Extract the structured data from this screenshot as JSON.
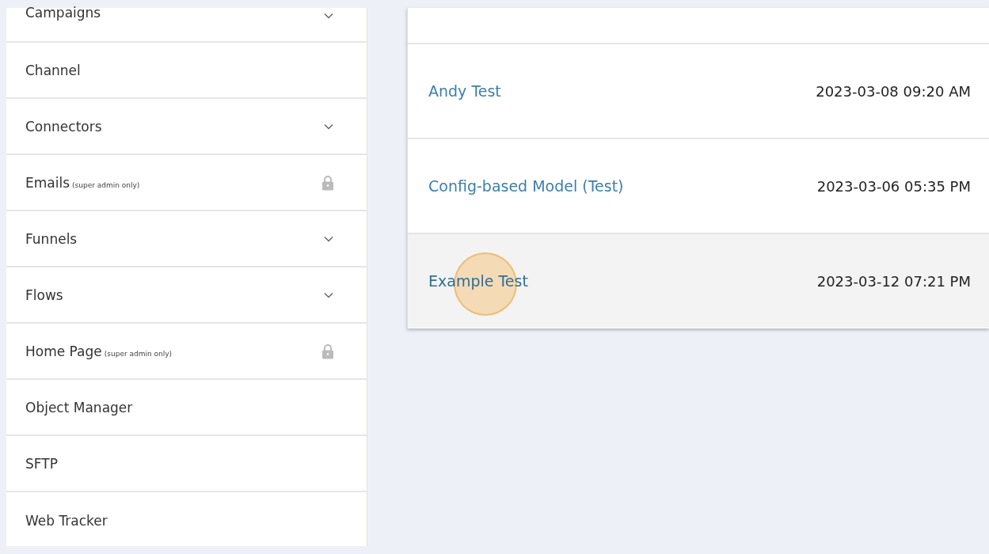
{
  "sidebar": {
    "items": [
      {
        "label": "Campaigns",
        "kind": "expandable"
      },
      {
        "label": "Channel",
        "kind": "plain"
      },
      {
        "label": "Connectors",
        "kind": "expandable"
      },
      {
        "label": "Emails",
        "note": "(super admin only)",
        "kind": "locked"
      },
      {
        "label": "Funnels",
        "kind": "expandable"
      },
      {
        "label": "Flows",
        "kind": "expandable"
      },
      {
        "label": "Home Page",
        "note": "(super admin only)",
        "kind": "locked"
      },
      {
        "label": "Object Manager",
        "kind": "plain"
      },
      {
        "label": "SFTP",
        "kind": "plain"
      },
      {
        "label": "Web Tracker",
        "kind": "plain"
      }
    ]
  },
  "list": {
    "rows": [
      {
        "name": "Andy Test",
        "date": "2023-03-08 09:20 AM",
        "highlighted": false
      },
      {
        "name": "Config-based Model (Test)",
        "date": "2023-03-06 05:35 PM",
        "highlighted": false
      },
      {
        "name": "Example Test",
        "date": "2023-03-12 07:21 PM",
        "highlighted": true,
        "clicked": true
      }
    ]
  }
}
